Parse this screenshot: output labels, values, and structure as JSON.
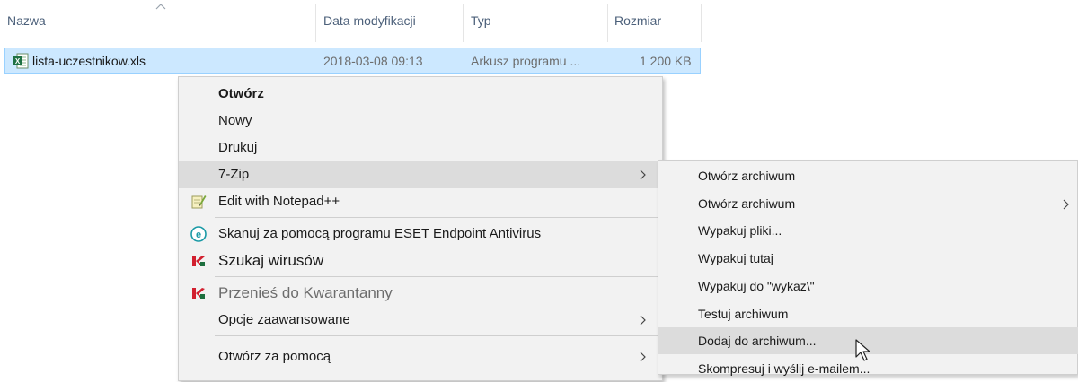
{
  "header": {
    "columns": [
      {
        "label": "Nazwa"
      },
      {
        "label": "Data modyfikacji"
      },
      {
        "label": "Typ"
      },
      {
        "label": "Rozmiar"
      }
    ],
    "sort_icon": "chevron-up-icon"
  },
  "file": {
    "icon": "excel-file-icon",
    "name": "lista-uczestnikow.xls",
    "modified": "2018-03-08 09:13",
    "type": "Arkusz programu ...",
    "size": "1 200 KB"
  },
  "context_menu": {
    "items": [
      {
        "label": "Otwórz"
      },
      {
        "label": "Nowy"
      },
      {
        "label": "Drukuj"
      },
      {
        "label": "7-Zip"
      },
      {
        "label": "Edit with Notepad++",
        "icon": "notepadpp-icon"
      },
      {
        "label": "Skanuj za pomocą programu ESET Endpoint Antivirus",
        "icon": "eset-icon"
      },
      {
        "label": "Szukaj wirusów",
        "icon": "kaspersky-icon"
      },
      {
        "label": "Przenieś do Kwarantanny",
        "icon": "kaspersky-icon"
      },
      {
        "label": "Opcje zaawansowane"
      },
      {
        "label": "Otwórz za pomocą"
      }
    ]
  },
  "submenu_7zip": {
    "items": [
      {
        "label": "Otwórz archiwum"
      },
      {
        "label": "Otwórz archiwum"
      },
      {
        "label": "Wypakuj pliki..."
      },
      {
        "label": "Wypakuj tutaj"
      },
      {
        "label": "Wypakuj do \"wykaz\\\""
      },
      {
        "label": "Testuj archiwum"
      },
      {
        "label": "Dodaj do archiwum..."
      },
      {
        "label": "Skompresuj i wyślij e-mailem..."
      }
    ]
  },
  "colors": {
    "selection": "#cce8ff",
    "menu_bg": "#f2f2f2",
    "menu_hover": "#dcdcdc",
    "header_text": "#4c607a"
  }
}
